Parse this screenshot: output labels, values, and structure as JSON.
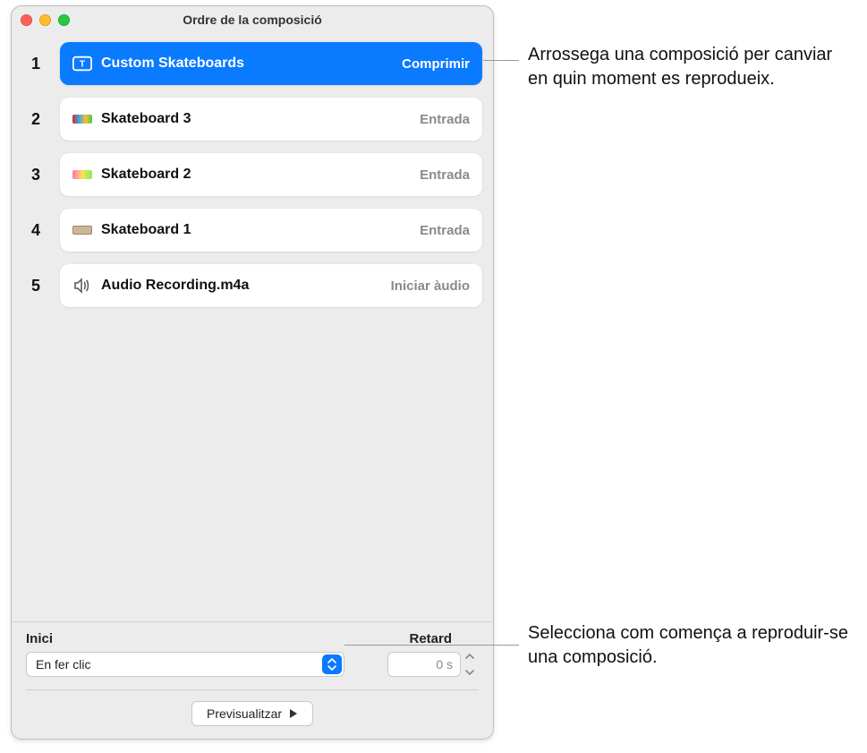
{
  "window": {
    "title": "Ordre de la composició"
  },
  "items": [
    {
      "num": "1",
      "title": "Custom Skateboards",
      "action": "Comprimir",
      "icon": "textbox",
      "selected": true
    },
    {
      "num": "2",
      "title": "Skateboard 3",
      "action": "Entrada",
      "icon": "sk3",
      "selected": false
    },
    {
      "num": "3",
      "title": "Skateboard 2",
      "action": "Entrada",
      "icon": "sk2",
      "selected": false
    },
    {
      "num": "4",
      "title": "Skateboard 1",
      "action": "Entrada",
      "icon": "sk1",
      "selected": false
    },
    {
      "num": "5",
      "title": "Audio Recording.m4a",
      "action": "Iniciar àudio",
      "icon": "audio",
      "selected": false
    }
  ],
  "controls": {
    "start_label": "Inici",
    "start_value": "En fer clic",
    "delay_label": "Retard",
    "delay_value": "0 s",
    "preview_label": "Previsualitzar"
  },
  "callouts": {
    "drag": "Arrossega una composició per canviar en quin moment es reprodueix.",
    "start": "Selecciona com comença a reproduir-se una composició."
  }
}
